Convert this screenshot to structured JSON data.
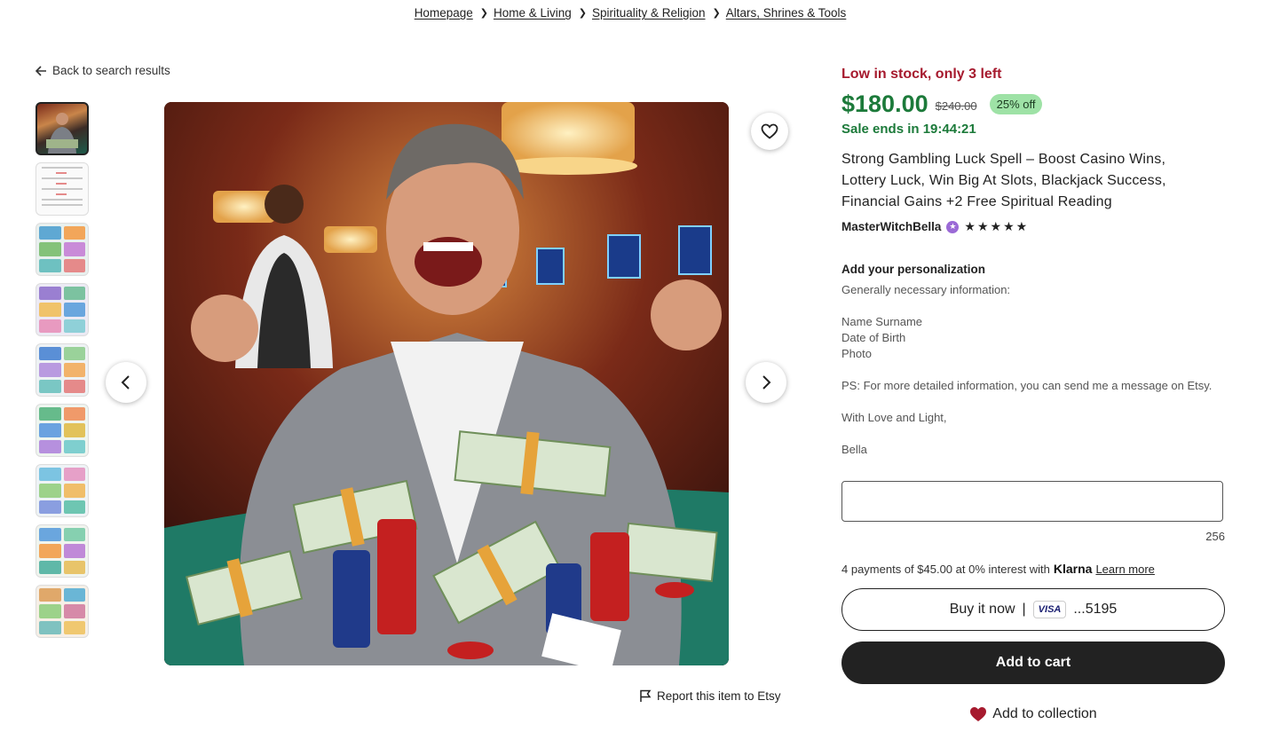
{
  "breadcrumb": [
    {
      "label": "Homepage"
    },
    {
      "label": "Home & Living"
    },
    {
      "label": "Spirituality & Religion"
    },
    {
      "label": "Altars, Shrines & Tools"
    }
  ],
  "back_link": "Back to search results",
  "report_link": "Report this item to Etsy",
  "listing": {
    "stock": "Low in stock, only 3 left",
    "price": "$180.00",
    "original_price": "$240.00",
    "discount": "25% off",
    "sale_ends": "Sale ends in 19:44:21",
    "title": "Strong Gambling Luck Spell – Boost Casino Wins, Lottery Luck, Win Big At Slots, Blackjack Success, Financial Gains +2 Free Spiritual Reading",
    "shop_name": "MasterWitchBella",
    "rating_stars": "★★★★★",
    "rating": 5
  },
  "personalization": {
    "title": "Add your personalization",
    "instructions": "Generally necessary information:\n\nName Surname\nDate of Birth\nPhoto\n\nPS: For more detailed information, you can send me a message on Etsy.\n\nWith Love and Light,\n\nBella",
    "input_value": "",
    "char_count": "256"
  },
  "klarna": {
    "text": "4 payments of $45.00 at 0% interest with",
    "logo": "Klarna",
    "link": "Learn more"
  },
  "buttons": {
    "buy_now": "Buy it now",
    "card_brand": "VISA",
    "card_last4": "...5195",
    "add_to_cart": "Add to cart",
    "add_to_collection": "Add to collection"
  },
  "colors": {
    "stock_red": "#a61a2e",
    "price_green": "#1c7a3a",
    "discount_badge": "#9ee2a6",
    "heart_red": "#a61a2e"
  }
}
